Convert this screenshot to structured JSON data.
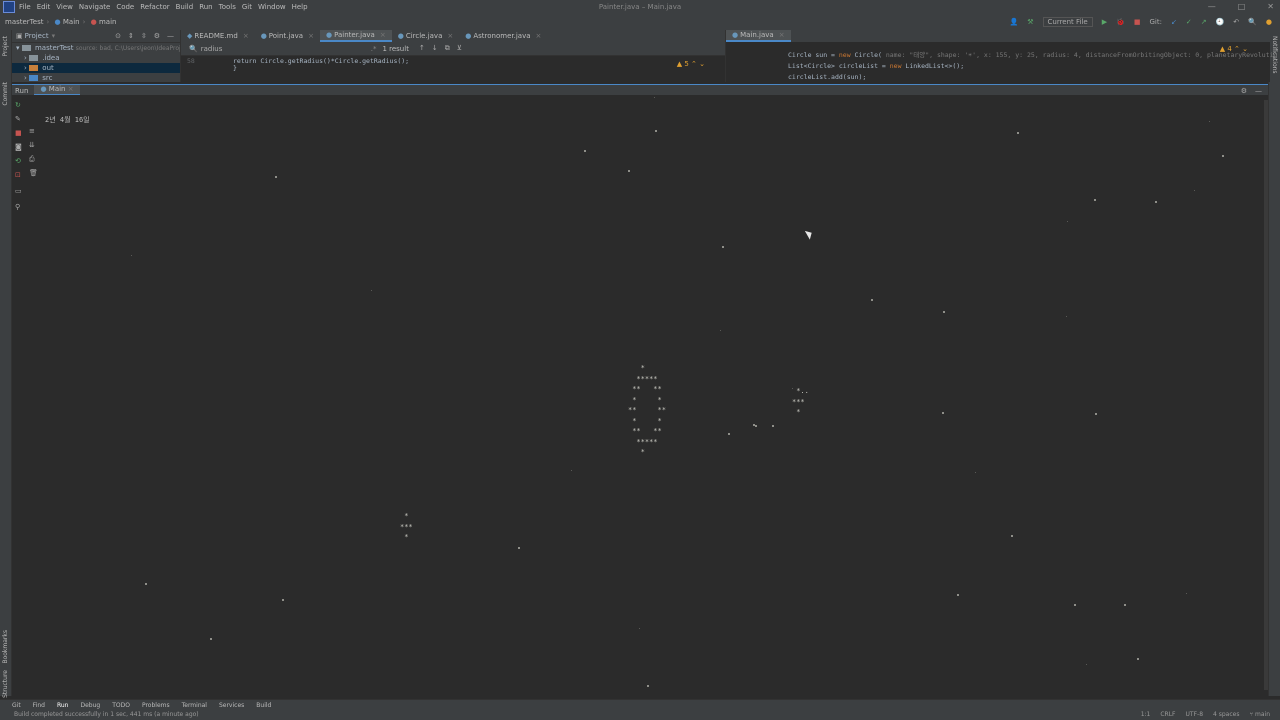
{
  "window": {
    "title": "Painter.java – Main.java",
    "menu": [
      "File",
      "Edit",
      "View",
      "Navigate",
      "Code",
      "Refactor",
      "Build",
      "Run",
      "Tools",
      "Git",
      "Window",
      "Help"
    ]
  },
  "nav": {
    "project": "masterTest",
    "file": "Main",
    "method": "main",
    "run_config": "Current File",
    "git_label": "Git:"
  },
  "project_panel": {
    "title": "Project",
    "root": "masterTest",
    "root_path": "source: bad, C:\\Users\\jeon\\IdeaProjects\\masterTest",
    "items": [
      ".idea",
      "out",
      "src"
    ]
  },
  "editor_left": {
    "tabs": [
      {
        "label": "README.md",
        "color": "#6897bb"
      },
      {
        "label": "Point.java",
        "color": "#6897bb"
      },
      {
        "label": "Painter.java",
        "color": "#6897bb",
        "active": true
      },
      {
        "label": "Circle.java",
        "color": "#6897bb"
      },
      {
        "label": "Astronomer.java",
        "color": "#6897bb"
      }
    ],
    "search_text": "radius",
    "search_result": "1 result",
    "line_no": "58",
    "code_line": "return Circle.getRadius()*Circle.getRadius();",
    "warnings": "5"
  },
  "editor_right": {
    "tab": "Main.java",
    "warnings": "4",
    "lines": [
      {
        "kw": "",
        "text": "Circle sun = ",
        "kw2": "new",
        "rest": " Circle(",
        "hint": " name: \"태양\",  shape: '☀',  x: 155,  y: 25,  radius: 4,  distanceFromOrbitingObject: 0,  planetaryRevolutio"
      },
      {
        "kw": "",
        "text": "List<Circle> circleList = ",
        "kw2": "new",
        "rest": " LinkedList<>();",
        "hint": ""
      },
      {
        "kw": "",
        "text": "circleList.add(sun);",
        "kw2": "",
        "rest": "",
        "hint": ""
      }
    ]
  },
  "run_panel": {
    "label": "Run",
    "tab": "Main",
    "console_date": "2년 4월 16일",
    "sun_art": "   *\n  *****\n **   **\n *     *\n**     **\n *     *\n **   **\n  *****\n   *",
    "planet_art_1": " *..\n***\n *",
    "planet_art_2": " *\n***\n *"
  },
  "bottom_tabs": [
    "Git",
    "Find",
    "Run",
    "Debug",
    "TODO",
    "Problems",
    "Terminal",
    "Services",
    "Build"
  ],
  "status": {
    "message": "Build completed successfully in 1 sec, 441 ms (a minute ago)",
    "position": "1:1",
    "line_sep": "CRLF",
    "encoding": "UTF-8",
    "indent": "4 spaces",
    "branch": "main"
  },
  "colors": {
    "accent": "#4a88c7",
    "background": "#2b2b2b",
    "panel": "#3c3f41",
    "star": "#b0b0a8"
  }
}
